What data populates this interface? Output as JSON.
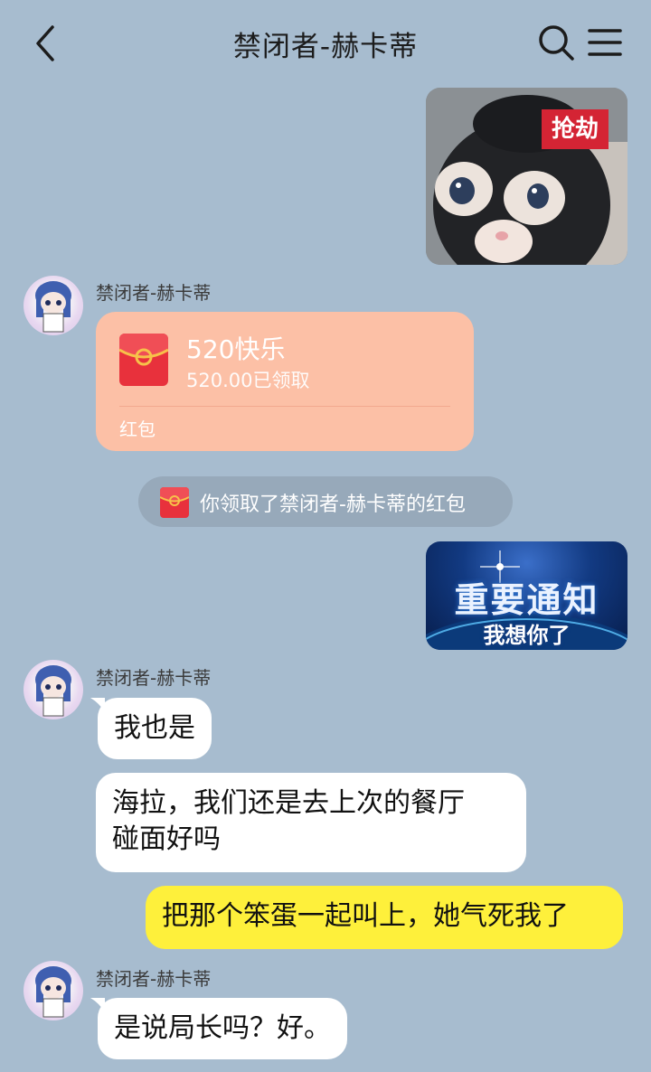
{
  "header": {
    "title": "禁闭者-赫卡蒂"
  },
  "sticker1": {
    "tag": "抢劫"
  },
  "sender_name": "禁闭者-赫卡蒂",
  "red_packet": {
    "title": "520快乐",
    "subtitle": "520.00已领取",
    "label": "红包"
  },
  "system_notice": {
    "text": "你领取了禁闭者-赫卡蒂的红包"
  },
  "sticker2": {
    "title": "重要通知",
    "subtitle": "我想你了"
  },
  "messages": [
    {
      "text": "我也是"
    },
    {
      "text_line1": "海拉，我们还是去上次的餐厅",
      "text_line2": "碰面好吗"
    },
    {
      "text": "把那个笨蛋一起叫上，她气死我了"
    },
    {
      "text": "是说局长吗？好。"
    }
  ],
  "colors": {
    "background": "#a7bccf",
    "self_bubble": "#fef03b",
    "other_bubble": "#ffffff",
    "red_packet": "#fcc0a6",
    "notice_pill": "#97a9ba"
  },
  "icons": [
    "back-icon",
    "search-icon",
    "menu-icon",
    "red-packet-icon"
  ]
}
